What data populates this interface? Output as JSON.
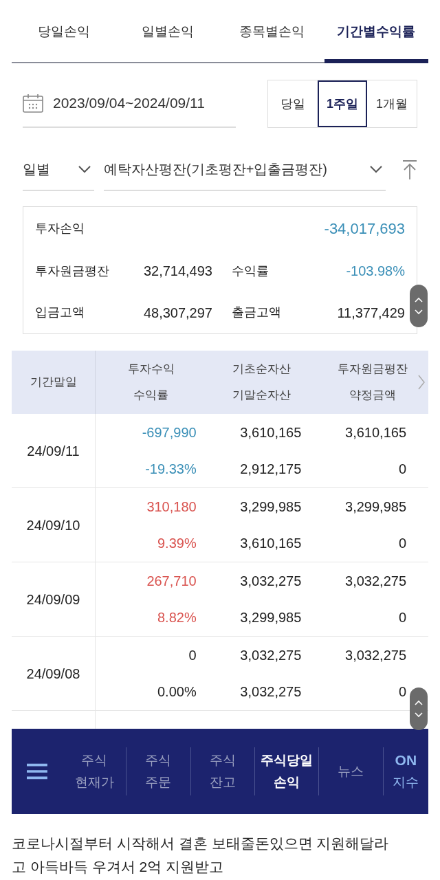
{
  "tabs": [
    {
      "label": "당일손익",
      "selected": false
    },
    {
      "label": "일별손익",
      "selected": false
    },
    {
      "label": "종목별손익",
      "selected": false
    },
    {
      "label": "기간별수익률",
      "selected": true
    }
  ],
  "date_range": {
    "value": "2023/09/04~2024/09/11"
  },
  "periods": [
    {
      "label": "당일",
      "selected": false
    },
    {
      "label": "1주일",
      "selected": true
    },
    {
      "label": "1개월",
      "selected": false
    }
  ],
  "filters": [
    {
      "value": "일별"
    },
    {
      "value": "예탁자산평잔(기초평잔+입출금평잔)"
    }
  ],
  "summary": {
    "total": {
      "label": "투자손익",
      "value": "-34,017,693",
      "color": "#3a8fb7"
    },
    "pairs": [
      {
        "left": {
          "label": "투자원금평잔",
          "value": "32,714,493"
        },
        "right": {
          "label": "수익률",
          "value": "-103.98%",
          "color": "#3a8fb7"
        }
      },
      {
        "left": {
          "label": "입금고액",
          "value": "48,307,297"
        },
        "right": {
          "label": "출금고액",
          "value": "11,377,429",
          "color": "#222222"
        }
      }
    ]
  },
  "table": {
    "first_column": "기간말일",
    "columns": [
      [
        "투자수익",
        "수익률"
      ],
      [
        "기초순자산",
        "기말순자산"
      ],
      [
        "투자원금평잔",
        "약정금액"
      ]
    ],
    "rows": [
      {
        "date": "24/09/11",
        "color": "#3a8fb7",
        "profit": "-697,990",
        "rate": "-19.33%",
        "begin": "3,610,165",
        "end": "2,912,175",
        "principal": "3,610,165",
        "contract": "0"
      },
      {
        "date": "24/09/10",
        "color": "#d9534f",
        "profit": "310,180",
        "rate": "9.39%",
        "begin": "3,299,985",
        "end": "3,610,165",
        "principal": "3,299,985",
        "contract": "0"
      },
      {
        "date": "24/09/09",
        "color": "#d9534f",
        "profit": "267,710",
        "rate": "8.82%",
        "begin": "3,032,275",
        "end": "3,299,985",
        "principal": "3,032,275",
        "contract": "0"
      },
      {
        "date": "24/09/08",
        "color": "#222222",
        "profit": "0",
        "rate": "0.00%",
        "begin": "3,032,275",
        "end": "3,032,275",
        "principal": "3,032,275",
        "contract": "0"
      }
    ]
  },
  "bottom_nav": [
    {
      "kind": "item",
      "lines": [
        "주식",
        "현재가"
      ],
      "selected": false
    },
    {
      "kind": "item",
      "lines": [
        "주식",
        "주문"
      ],
      "selected": false
    },
    {
      "kind": "item",
      "lines": [
        "주식",
        "잔고"
      ],
      "selected": false
    },
    {
      "kind": "item",
      "lines": [
        "주식당일",
        "손익"
      ],
      "selected": true
    },
    {
      "kind": "item",
      "lines": [
        "뉴스"
      ],
      "selected": false
    },
    {
      "kind": "badge",
      "lines": [
        "ON",
        "지수"
      ],
      "selected": false
    }
  ],
  "post_text": [
    "코로나시절부터 시작해서 결혼 보태줄돈있으면 지원해달라",
    "고 아득바득 우겨서 2억 지원받고"
  ]
}
